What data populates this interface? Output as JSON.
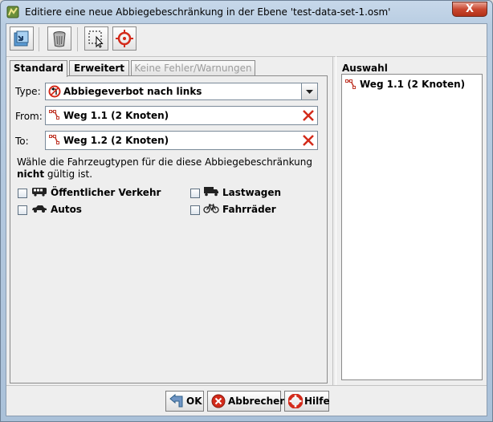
{
  "window": {
    "title": "Editiere eine neue Abbiegebeschränkung in der Ebene 'test-data-set-1.osm'",
    "close_label": "X"
  },
  "toolbar": {
    "buttons": [
      {
        "name": "apply-icon"
      },
      {
        "name": "trash-icon"
      },
      {
        "name": "select-icon"
      },
      {
        "name": "zoom-to-icon"
      }
    ]
  },
  "tabs": [
    {
      "label": "Standard",
      "state": "active"
    },
    {
      "label": "Erweitert",
      "state": "normal"
    },
    {
      "label": "Keine Fehler/Warnungen",
      "state": "disabled"
    }
  ],
  "form": {
    "type_label": "Type:",
    "type_value": "Abbiegeverbot nach links",
    "from_label": "From:",
    "from_value": "Weg 1.1 (2 Knoten)",
    "to_label": "To:",
    "to_value": "Weg 1.2 (2 Knoten)",
    "description_start": "Wähle die Fahrzeugtypen für die diese Abbiegebeschränkung ",
    "description_bold": "nicht",
    "description_end": " gültig ist.",
    "vehicles": [
      {
        "label": "Öffentlicher Verkehr",
        "icon": "bus-icon",
        "checked": false
      },
      {
        "label": "Lastwagen",
        "icon": "truck-icon",
        "checked": false
      },
      {
        "label": "Autos",
        "icon": "car-icon",
        "checked": false
      },
      {
        "label": "Fahrräder",
        "icon": "bicycle-icon",
        "checked": false
      }
    ]
  },
  "selection": {
    "title": "Auswahl",
    "items": [
      {
        "label": "Weg 1.1 (2 Knoten)"
      }
    ]
  },
  "dialog_buttons": {
    "ok": "OK",
    "cancel": "Abbrechen",
    "help": "Hilfe"
  },
  "colors": {
    "accent_red": "#d32a1a",
    "way_icon": "#c0392b"
  }
}
